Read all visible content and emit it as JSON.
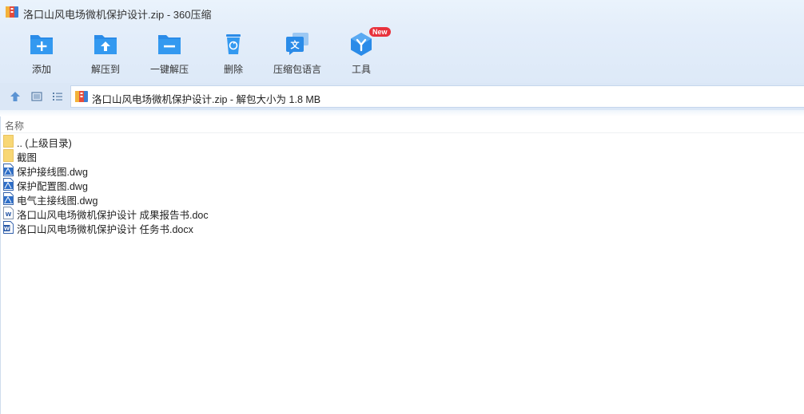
{
  "window": {
    "title": "洛口山风电场微机保护设计.zip - 360压缩"
  },
  "toolbar": {
    "items": [
      {
        "label": "添加",
        "icon": "add-folder-icon"
      },
      {
        "label": "解压到",
        "icon": "extract-to-icon"
      },
      {
        "label": "一键解压",
        "icon": "one-click-extract-icon"
      },
      {
        "label": "删除",
        "icon": "delete-icon"
      },
      {
        "label": "压缩包语言",
        "icon": "language-icon"
      },
      {
        "label": "工具",
        "icon": "tools-icon",
        "badge": "New"
      }
    ]
  },
  "addressbar": {
    "path": "洛口山风电场微机保护设计.zip - 解包大小为 1.8 MB"
  },
  "columns": {
    "name": "名称"
  },
  "files": [
    {
      "name": ".. (上级目录)",
      "type": "folder"
    },
    {
      "name": "截图",
      "type": "folder"
    },
    {
      "name": "保护接线图.dwg",
      "type": "dwg"
    },
    {
      "name": "保护配置图.dwg",
      "type": "dwg"
    },
    {
      "name": "电气主接线图.dwg",
      "type": "dwg"
    },
    {
      "name": "洛口山风电场微机保护设计 成果报告书.doc",
      "type": "doc"
    },
    {
      "name": "洛口山风电场微机保护设计 任务书.docx",
      "type": "docx"
    }
  ],
  "colors": {
    "accent": "#2a8be8",
    "folder": "#f8d775",
    "badge": "#e8323c"
  }
}
